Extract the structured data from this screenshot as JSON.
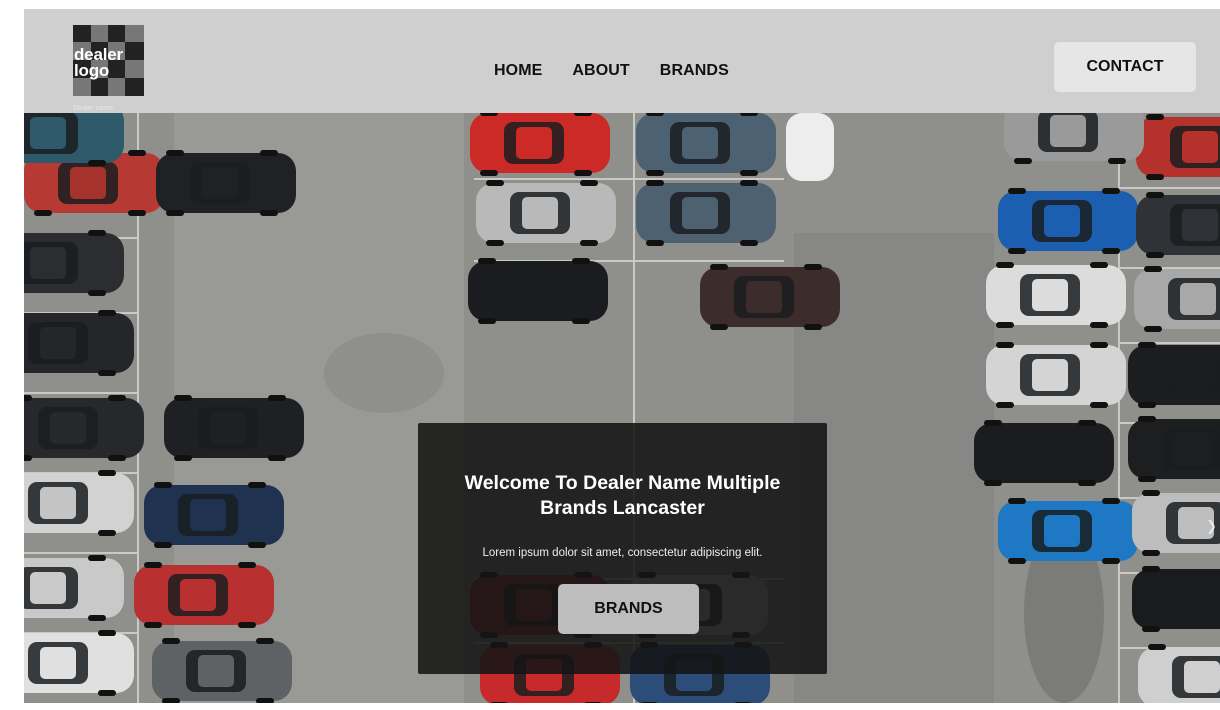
{
  "header": {
    "logo": {
      "line1": "dealer",
      "line2": "logo"
    },
    "dealer_name": "Dealer name",
    "nav": [
      {
        "label": "HOME"
      },
      {
        "label": "ABOUT"
      },
      {
        "label": "BRANDS"
      }
    ],
    "contact_label": "CONTACT"
  },
  "hero": {
    "title": "Welcome To Dealer Name Multiple Brands Lancaster",
    "text": "Lorem ipsum dolor sit amet, consectetur adipiscing elit.",
    "button_label": "BRANDS",
    "next_arrow": "chevron-right-icon"
  },
  "colors": {
    "header_bg": "#cfcfcf",
    "lot_bg": "#8d8d8b",
    "overlay_bg": "#141414",
    "button_bg": "#bdbdbd"
  }
}
